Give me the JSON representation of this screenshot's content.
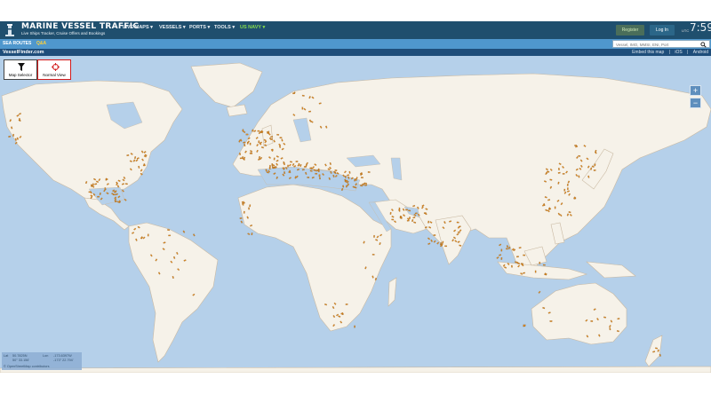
{
  "header": {
    "brand": "MARINE VESSEL TRAFFIC",
    "tagline": "Live Ships Tracker, Cruise Offers and Bookings",
    "nav": [
      {
        "label": "LIVE MAPS ▾",
        "highlight": false
      },
      {
        "label": "VESSELS ▾",
        "highlight": false
      },
      {
        "label": "PORTS ▾",
        "highlight": false
      },
      {
        "label": "TOOLS ▾",
        "highlight": false
      },
      {
        "label": "US NAVY ▾",
        "highlight": true
      }
    ],
    "register_label": "Register",
    "login_label": "Log In",
    "utc_label": "UTC",
    "clock": "7:59",
    "nav_color": "#1f4f6e",
    "highlight_color": "#86dc4e"
  },
  "subbar": {
    "sea_routes_label": "SEA ROUTES",
    "qa_label": "Q&A",
    "search_placeholder": "Vessel, IMO, MMSI, ENI, Port",
    "search_icon": "search-icon"
  },
  "bar3": {
    "site_label": "VesselFinder.com",
    "links": [
      "Embed this map",
      "|",
      "iOS",
      "|",
      "Android"
    ]
  },
  "map": {
    "tools": [
      {
        "label": "Map Selector",
        "icon": "funnel-icon"
      },
      {
        "label": "Normal View",
        "icon": "crosshair-icon"
      }
    ],
    "zoom_in": "+",
    "zoom_out": "−",
    "ocean_color": "#b5d0ea",
    "land_color": "#f6f2e9",
    "vessel_color": "#e08a1f"
  },
  "coords": {
    "lat_label": "Lat",
    "lat_value": "50.7825N",
    "lat_dms": "50° 33.156'",
    "lon_label": "Lon",
    "lon_value": "-173.6397W",
    "lon_dms": "-173° 22.794'",
    "attribution": "© OpenStreetMap contributors"
  }
}
